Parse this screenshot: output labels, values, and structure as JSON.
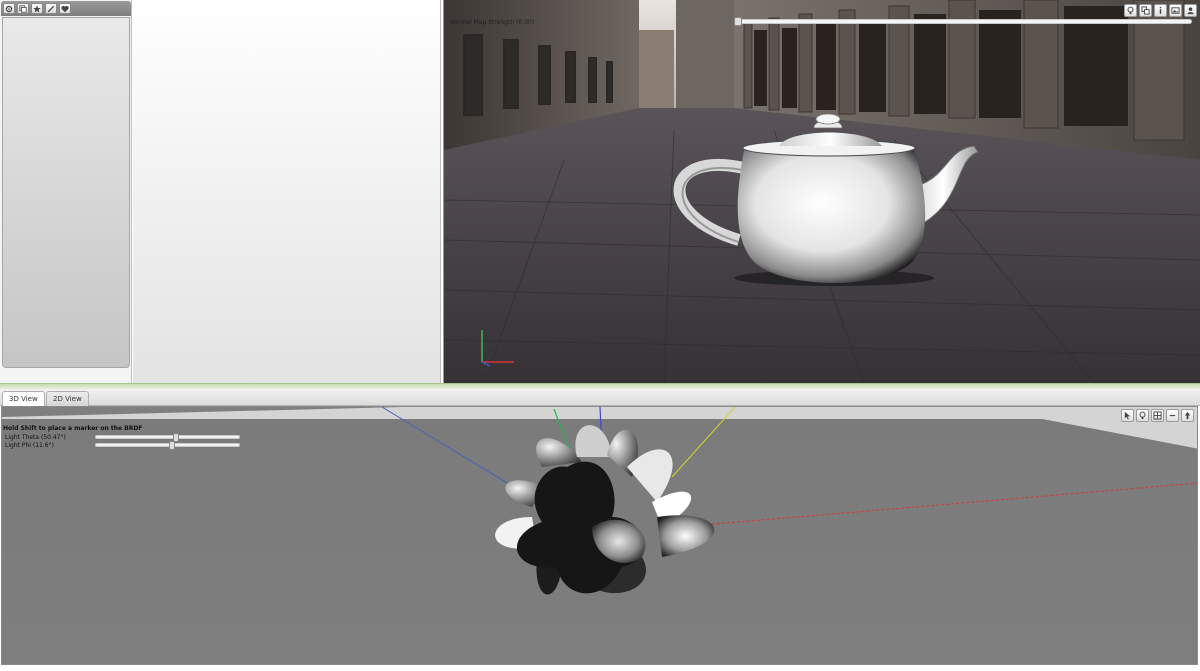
{
  "left_toolbar": {
    "icons": [
      "gear-icon",
      "layers-icon",
      "star-icon",
      "pencil-icon",
      "heart-icon"
    ]
  },
  "viewport": {
    "normal_map_label": "Normal Map Strength (0.00)",
    "normal_map_value": 0.0,
    "buttons": [
      "lightbulb-icon",
      "layers-icon",
      "info-icon",
      "image-icon",
      "user-icon"
    ]
  },
  "bottom": {
    "tabs": [
      {
        "label": "3D View",
        "active": true
      },
      {
        "label": "2D View",
        "active": false
      }
    ],
    "hint": "Hold Shift to place a marker on the BRDF",
    "controls": [
      {
        "label": "Light Theta (50.47°)",
        "value_fraction": 0.56
      },
      {
        "label": "Light Phi (11.6°)",
        "value_fraction": 0.53
      }
    ],
    "buttons": [
      "cursor-icon",
      "lightbulb-icon",
      "grid-icon",
      "minus-icon",
      "arrow-up-icon"
    ]
  }
}
